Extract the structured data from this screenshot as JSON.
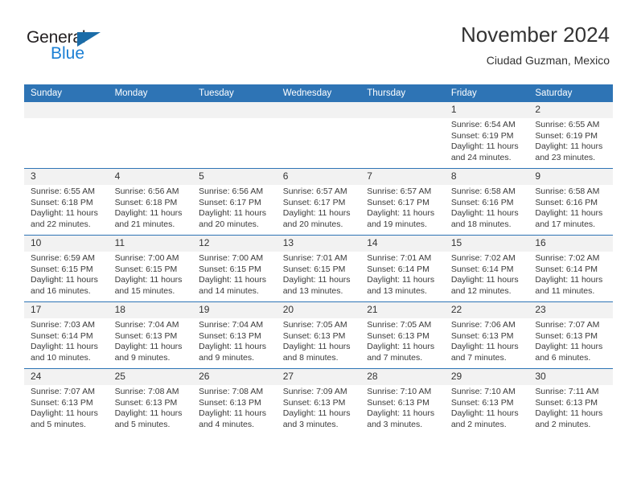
{
  "brand": {
    "name_part1": "General",
    "name_part2": "Blue",
    "triangle_icon": "triangle-icon"
  },
  "header": {
    "title": "November 2024",
    "subtitle": "Ciudad Guzman, Mexico"
  },
  "calendar": {
    "weekday_headers": [
      "Sunday",
      "Monday",
      "Tuesday",
      "Wednesday",
      "Thursday",
      "Friday",
      "Saturday"
    ],
    "accent_color": "#2e74b5",
    "date_strip_color": "#f2f2f2",
    "weeks": [
      {
        "days": [
          {
            "date": "",
            "lines": [
              "",
              "",
              "",
              ""
            ]
          },
          {
            "date": "",
            "lines": [
              "",
              "",
              "",
              ""
            ]
          },
          {
            "date": "",
            "lines": [
              "",
              "",
              "",
              ""
            ]
          },
          {
            "date": "",
            "lines": [
              "",
              "",
              "",
              ""
            ]
          },
          {
            "date": "",
            "lines": [
              "",
              "",
              "",
              ""
            ]
          },
          {
            "date": "1",
            "lines": [
              "Sunrise: 6:54 AM",
              "Sunset: 6:19 PM",
              "Daylight: 11 hours",
              "and 24 minutes."
            ]
          },
          {
            "date": "2",
            "lines": [
              "Sunrise: 6:55 AM",
              "Sunset: 6:19 PM",
              "Daylight: 11 hours",
              "and 23 minutes."
            ]
          }
        ]
      },
      {
        "days": [
          {
            "date": "3",
            "lines": [
              "Sunrise: 6:55 AM",
              "Sunset: 6:18 PM",
              "Daylight: 11 hours",
              "and 22 minutes."
            ]
          },
          {
            "date": "4",
            "lines": [
              "Sunrise: 6:56 AM",
              "Sunset: 6:18 PM",
              "Daylight: 11 hours",
              "and 21 minutes."
            ]
          },
          {
            "date": "5",
            "lines": [
              "Sunrise: 6:56 AM",
              "Sunset: 6:17 PM",
              "Daylight: 11 hours",
              "and 20 minutes."
            ]
          },
          {
            "date": "6",
            "lines": [
              "Sunrise: 6:57 AM",
              "Sunset: 6:17 PM",
              "Daylight: 11 hours",
              "and 20 minutes."
            ]
          },
          {
            "date": "7",
            "lines": [
              "Sunrise: 6:57 AM",
              "Sunset: 6:17 PM",
              "Daylight: 11 hours",
              "and 19 minutes."
            ]
          },
          {
            "date": "8",
            "lines": [
              "Sunrise: 6:58 AM",
              "Sunset: 6:16 PM",
              "Daylight: 11 hours",
              "and 18 minutes."
            ]
          },
          {
            "date": "9",
            "lines": [
              "Sunrise: 6:58 AM",
              "Sunset: 6:16 PM",
              "Daylight: 11 hours",
              "and 17 minutes."
            ]
          }
        ]
      },
      {
        "days": [
          {
            "date": "10",
            "lines": [
              "Sunrise: 6:59 AM",
              "Sunset: 6:15 PM",
              "Daylight: 11 hours",
              "and 16 minutes."
            ]
          },
          {
            "date": "11",
            "lines": [
              "Sunrise: 7:00 AM",
              "Sunset: 6:15 PM",
              "Daylight: 11 hours",
              "and 15 minutes."
            ]
          },
          {
            "date": "12",
            "lines": [
              "Sunrise: 7:00 AM",
              "Sunset: 6:15 PM",
              "Daylight: 11 hours",
              "and 14 minutes."
            ]
          },
          {
            "date": "13",
            "lines": [
              "Sunrise: 7:01 AM",
              "Sunset: 6:15 PM",
              "Daylight: 11 hours",
              "and 13 minutes."
            ]
          },
          {
            "date": "14",
            "lines": [
              "Sunrise: 7:01 AM",
              "Sunset: 6:14 PM",
              "Daylight: 11 hours",
              "and 13 minutes."
            ]
          },
          {
            "date": "15",
            "lines": [
              "Sunrise: 7:02 AM",
              "Sunset: 6:14 PM",
              "Daylight: 11 hours",
              "and 12 minutes."
            ]
          },
          {
            "date": "16",
            "lines": [
              "Sunrise: 7:02 AM",
              "Sunset: 6:14 PM",
              "Daylight: 11 hours",
              "and 11 minutes."
            ]
          }
        ]
      },
      {
        "days": [
          {
            "date": "17",
            "lines": [
              "Sunrise: 7:03 AM",
              "Sunset: 6:14 PM",
              "Daylight: 11 hours",
              "and 10 minutes."
            ]
          },
          {
            "date": "18",
            "lines": [
              "Sunrise: 7:04 AM",
              "Sunset: 6:13 PM",
              "Daylight: 11 hours",
              "and 9 minutes."
            ]
          },
          {
            "date": "19",
            "lines": [
              "Sunrise: 7:04 AM",
              "Sunset: 6:13 PM",
              "Daylight: 11 hours",
              "and 9 minutes."
            ]
          },
          {
            "date": "20",
            "lines": [
              "Sunrise: 7:05 AM",
              "Sunset: 6:13 PM",
              "Daylight: 11 hours",
              "and 8 minutes."
            ]
          },
          {
            "date": "21",
            "lines": [
              "Sunrise: 7:05 AM",
              "Sunset: 6:13 PM",
              "Daylight: 11 hours",
              "and 7 minutes."
            ]
          },
          {
            "date": "22",
            "lines": [
              "Sunrise: 7:06 AM",
              "Sunset: 6:13 PM",
              "Daylight: 11 hours",
              "and 7 minutes."
            ]
          },
          {
            "date": "23",
            "lines": [
              "Sunrise: 7:07 AM",
              "Sunset: 6:13 PM",
              "Daylight: 11 hours",
              "and 6 minutes."
            ]
          }
        ]
      },
      {
        "days": [
          {
            "date": "24",
            "lines": [
              "Sunrise: 7:07 AM",
              "Sunset: 6:13 PM",
              "Daylight: 11 hours",
              "and 5 minutes."
            ]
          },
          {
            "date": "25",
            "lines": [
              "Sunrise: 7:08 AM",
              "Sunset: 6:13 PM",
              "Daylight: 11 hours",
              "and 5 minutes."
            ]
          },
          {
            "date": "26",
            "lines": [
              "Sunrise: 7:08 AM",
              "Sunset: 6:13 PM",
              "Daylight: 11 hours",
              "and 4 minutes."
            ]
          },
          {
            "date": "27",
            "lines": [
              "Sunrise: 7:09 AM",
              "Sunset: 6:13 PM",
              "Daylight: 11 hours",
              "and 3 minutes."
            ]
          },
          {
            "date": "28",
            "lines": [
              "Sunrise: 7:10 AM",
              "Sunset: 6:13 PM",
              "Daylight: 11 hours",
              "and 3 minutes."
            ]
          },
          {
            "date": "29",
            "lines": [
              "Sunrise: 7:10 AM",
              "Sunset: 6:13 PM",
              "Daylight: 11 hours",
              "and 2 minutes."
            ]
          },
          {
            "date": "30",
            "lines": [
              "Sunrise: 7:11 AM",
              "Sunset: 6:13 PM",
              "Daylight: 11 hours",
              "and 2 minutes."
            ]
          }
        ]
      }
    ]
  }
}
